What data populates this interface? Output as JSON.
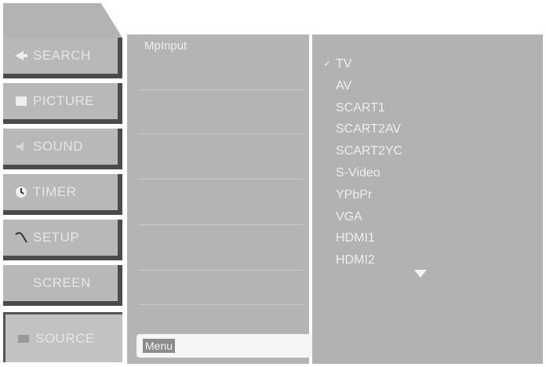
{
  "sidebar": {
    "items": [
      {
        "label": "SEARCH",
        "icon": "search-icon"
      },
      {
        "label": "PICTURE",
        "icon": "picture-icon"
      },
      {
        "label": "SOUND",
        "icon": "sound-icon"
      },
      {
        "label": "TIMER",
        "icon": "clock-icon"
      },
      {
        "label": "SETUP",
        "icon": "wrench-icon"
      },
      {
        "label": "SCREEN",
        "icon": "screen-icon"
      },
      {
        "label": "SOURCE",
        "icon": "source-icon"
      }
    ]
  },
  "middle": {
    "title": "MpInput",
    "menu_label": "Menu"
  },
  "sources": {
    "selected_mark": "✓",
    "items": [
      "TV",
      "AV",
      "SCART1",
      "SCART2AV",
      "SCART2YC",
      "S-Video",
      "YPbPr",
      "VGA",
      "HDMI1",
      "HDMI2"
    ]
  }
}
